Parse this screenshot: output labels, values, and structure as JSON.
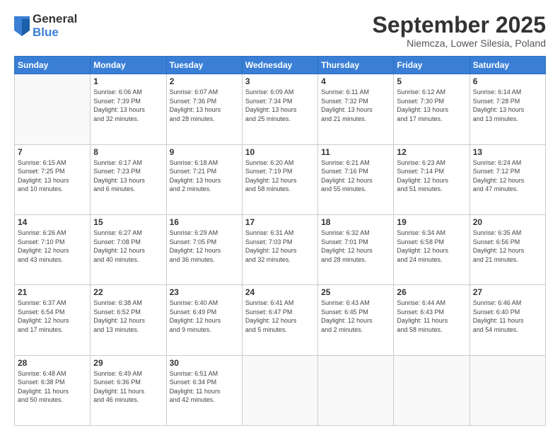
{
  "logo": {
    "general": "General",
    "blue": "Blue"
  },
  "title": "September 2025",
  "location": "Niemcza, Lower Silesia, Poland",
  "weekdays": [
    "Sunday",
    "Monday",
    "Tuesday",
    "Wednesday",
    "Thursday",
    "Friday",
    "Saturday"
  ],
  "weeks": [
    [
      {
        "day": "",
        "info": ""
      },
      {
        "day": "1",
        "info": "Sunrise: 6:06 AM\nSunset: 7:39 PM\nDaylight: 13 hours\nand 32 minutes."
      },
      {
        "day": "2",
        "info": "Sunrise: 6:07 AM\nSunset: 7:36 PM\nDaylight: 13 hours\nand 28 minutes."
      },
      {
        "day": "3",
        "info": "Sunrise: 6:09 AM\nSunset: 7:34 PM\nDaylight: 13 hours\nand 25 minutes."
      },
      {
        "day": "4",
        "info": "Sunrise: 6:11 AM\nSunset: 7:32 PM\nDaylight: 13 hours\nand 21 minutes."
      },
      {
        "day": "5",
        "info": "Sunrise: 6:12 AM\nSunset: 7:30 PM\nDaylight: 13 hours\nand 17 minutes."
      },
      {
        "day": "6",
        "info": "Sunrise: 6:14 AM\nSunset: 7:28 PM\nDaylight: 13 hours\nand 13 minutes."
      }
    ],
    [
      {
        "day": "7",
        "info": "Sunrise: 6:15 AM\nSunset: 7:25 PM\nDaylight: 13 hours\nand 10 minutes."
      },
      {
        "day": "8",
        "info": "Sunrise: 6:17 AM\nSunset: 7:23 PM\nDaylight: 13 hours\nand 6 minutes."
      },
      {
        "day": "9",
        "info": "Sunrise: 6:18 AM\nSunset: 7:21 PM\nDaylight: 13 hours\nand 2 minutes."
      },
      {
        "day": "10",
        "info": "Sunrise: 6:20 AM\nSunset: 7:19 PM\nDaylight: 12 hours\nand 58 minutes."
      },
      {
        "day": "11",
        "info": "Sunrise: 6:21 AM\nSunset: 7:16 PM\nDaylight: 12 hours\nand 55 minutes."
      },
      {
        "day": "12",
        "info": "Sunrise: 6:23 AM\nSunset: 7:14 PM\nDaylight: 12 hours\nand 51 minutes."
      },
      {
        "day": "13",
        "info": "Sunrise: 6:24 AM\nSunset: 7:12 PM\nDaylight: 12 hours\nand 47 minutes."
      }
    ],
    [
      {
        "day": "14",
        "info": "Sunrise: 6:26 AM\nSunset: 7:10 PM\nDaylight: 12 hours\nand 43 minutes."
      },
      {
        "day": "15",
        "info": "Sunrise: 6:27 AM\nSunset: 7:08 PM\nDaylight: 12 hours\nand 40 minutes."
      },
      {
        "day": "16",
        "info": "Sunrise: 6:29 AM\nSunset: 7:05 PM\nDaylight: 12 hours\nand 36 minutes."
      },
      {
        "day": "17",
        "info": "Sunrise: 6:31 AM\nSunset: 7:03 PM\nDaylight: 12 hours\nand 32 minutes."
      },
      {
        "day": "18",
        "info": "Sunrise: 6:32 AM\nSunset: 7:01 PM\nDaylight: 12 hours\nand 28 minutes."
      },
      {
        "day": "19",
        "info": "Sunrise: 6:34 AM\nSunset: 6:58 PM\nDaylight: 12 hours\nand 24 minutes."
      },
      {
        "day": "20",
        "info": "Sunrise: 6:35 AM\nSunset: 6:56 PM\nDaylight: 12 hours\nand 21 minutes."
      }
    ],
    [
      {
        "day": "21",
        "info": "Sunrise: 6:37 AM\nSunset: 6:54 PM\nDaylight: 12 hours\nand 17 minutes."
      },
      {
        "day": "22",
        "info": "Sunrise: 6:38 AM\nSunset: 6:52 PM\nDaylight: 12 hours\nand 13 minutes."
      },
      {
        "day": "23",
        "info": "Sunrise: 6:40 AM\nSunset: 6:49 PM\nDaylight: 12 hours\nand 9 minutes."
      },
      {
        "day": "24",
        "info": "Sunrise: 6:41 AM\nSunset: 6:47 PM\nDaylight: 12 hours\nand 5 minutes."
      },
      {
        "day": "25",
        "info": "Sunrise: 6:43 AM\nSunset: 6:45 PM\nDaylight: 12 hours\nand 2 minutes."
      },
      {
        "day": "26",
        "info": "Sunrise: 6:44 AM\nSunset: 6:43 PM\nDaylight: 11 hours\nand 58 minutes."
      },
      {
        "day": "27",
        "info": "Sunrise: 6:46 AM\nSunset: 6:40 PM\nDaylight: 11 hours\nand 54 minutes."
      }
    ],
    [
      {
        "day": "28",
        "info": "Sunrise: 6:48 AM\nSunset: 6:38 PM\nDaylight: 11 hours\nand 50 minutes."
      },
      {
        "day": "29",
        "info": "Sunrise: 6:49 AM\nSunset: 6:36 PM\nDaylight: 11 hours\nand 46 minutes."
      },
      {
        "day": "30",
        "info": "Sunrise: 6:51 AM\nSunset: 6:34 PM\nDaylight: 11 hours\nand 42 minutes."
      },
      {
        "day": "",
        "info": ""
      },
      {
        "day": "",
        "info": ""
      },
      {
        "day": "",
        "info": ""
      },
      {
        "day": "",
        "info": ""
      }
    ]
  ]
}
